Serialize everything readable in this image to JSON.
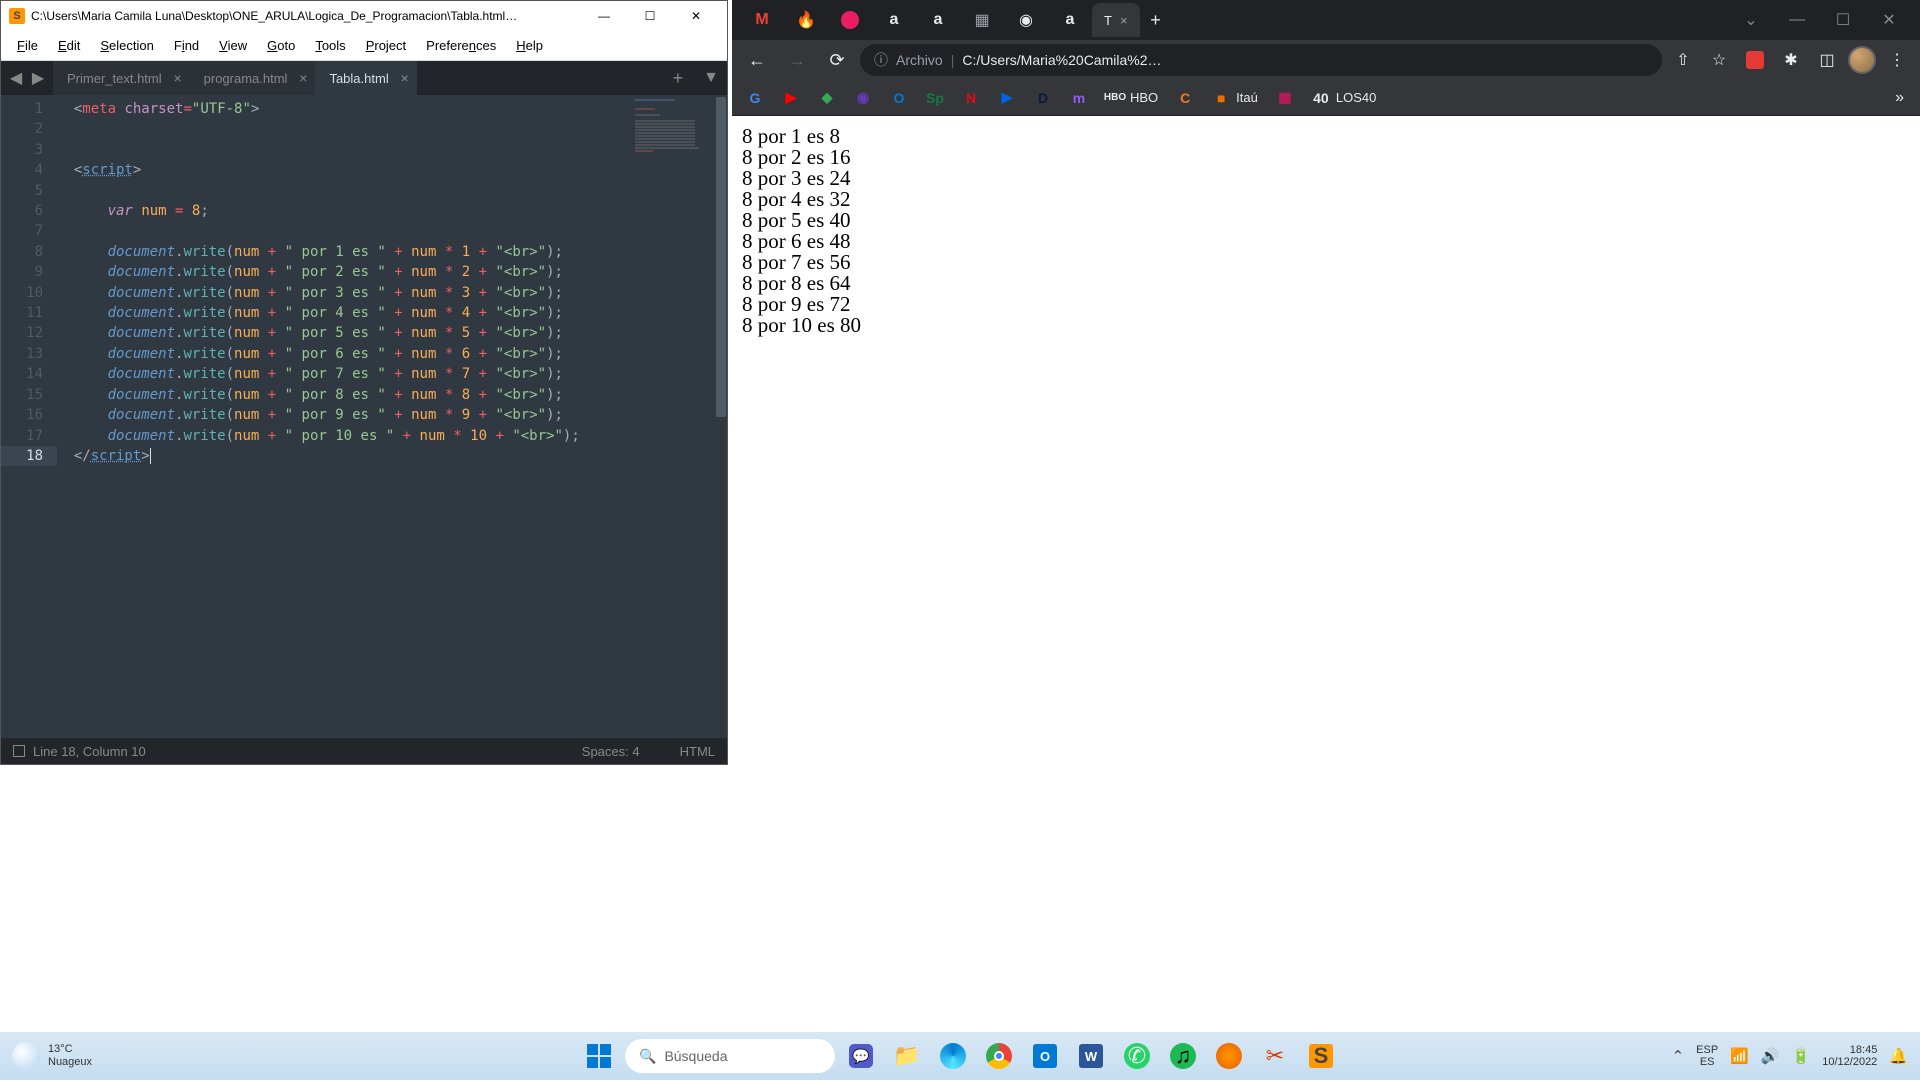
{
  "sublime": {
    "title": "C:\\Users\\Maria Camila Luna\\Desktop\\ONE_ARULA\\Logica_De_Programacion\\Tabla.html…",
    "menus": [
      "File",
      "Edit",
      "Selection",
      "Find",
      "View",
      "Goto",
      "Tools",
      "Project",
      "Preferences",
      "Help"
    ],
    "tabs": [
      {
        "label": "Primer_text.html",
        "active": false
      },
      {
        "label": "programa.html",
        "active": false
      },
      {
        "label": "Tabla.html",
        "active": true
      }
    ],
    "status_cursor": "Line 18, Column 10",
    "status_spaces": "Spaces: 4",
    "status_syntax": "HTML",
    "code_num": "8"
  },
  "chrome": {
    "addr_label": "Archivo",
    "addr_url": "C:/Users/Maria%20Camila%2…",
    "tab_active": "T",
    "bookmarks": [
      {
        "name": "google",
        "icon": "G",
        "color": "#4285f4"
      },
      {
        "name": "youtube",
        "icon": "▶",
        "color": "#ff0000"
      },
      {
        "name": "maps",
        "icon": "◆",
        "color": "#34a853"
      },
      {
        "name": "app1",
        "icon": "◉",
        "color": "#673ab7"
      },
      {
        "name": "outlook",
        "icon": "O",
        "color": "#0078d4"
      },
      {
        "name": "sp",
        "icon": "Sp",
        "color": "#107c41"
      },
      {
        "name": "netflix",
        "icon": "N",
        "color": "#e50914"
      },
      {
        "name": "disney",
        "icon": "▶",
        "color": "#0063e5"
      },
      {
        "name": "dplus",
        "icon": "D",
        "color": "#0a1b3d"
      },
      {
        "name": "mon",
        "icon": "m",
        "color": "#8b5cf6"
      },
      {
        "name": "hbo",
        "icon": "HBO",
        "text": "HBO",
        "color": "#e8eaed"
      },
      {
        "name": "cr",
        "icon": "C",
        "color": "#f47521"
      },
      {
        "name": "itau",
        "icon": "■",
        "text": "Itaú",
        "color": "#ec7000"
      },
      {
        "name": "misc",
        "icon": "▦",
        "color": "#c2185b"
      },
      {
        "name": "los40",
        "icon": "40",
        "text": "LOS40",
        "color": "#e8eaed"
      }
    ],
    "output_lines": [
      "8 por 1 es 8",
      "8 por 2 es 16",
      "8 por 3 es 24",
      "8 por 4 es 32",
      "8 por 5 es 40",
      "8 por 6 es 48",
      "8 por 7 es 56",
      "8 por 8 es 64",
      "8 por 9 es 72",
      "8 por 10 es 80"
    ]
  },
  "taskbar": {
    "weather_temp": "13°C",
    "weather_desc": "Nuageux",
    "search_placeholder": "Búsqueda",
    "lang_top": "ESP",
    "lang_bottom": "ES",
    "time": "18:45",
    "date": "10/12/2022"
  }
}
